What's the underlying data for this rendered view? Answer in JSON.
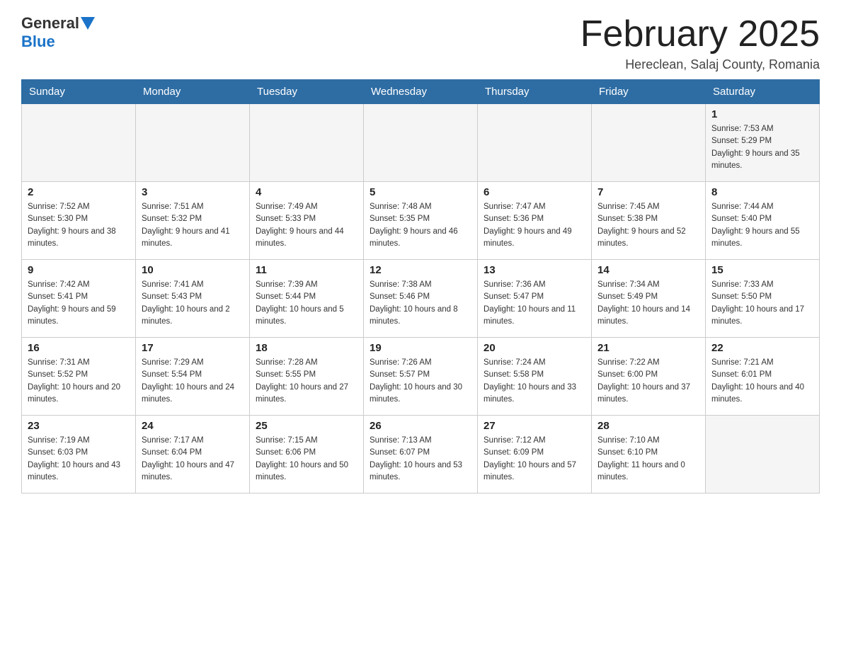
{
  "app": {
    "logo_general": "General",
    "logo_blue": "Blue"
  },
  "header": {
    "title": "February 2025",
    "subtitle": "Hereclean, Salaj County, Romania"
  },
  "weekdays": [
    "Sunday",
    "Monday",
    "Tuesday",
    "Wednesday",
    "Thursday",
    "Friday",
    "Saturday"
  ],
  "weeks": [
    [
      {
        "day": "",
        "info": ""
      },
      {
        "day": "",
        "info": ""
      },
      {
        "day": "",
        "info": ""
      },
      {
        "day": "",
        "info": ""
      },
      {
        "day": "",
        "info": ""
      },
      {
        "day": "",
        "info": ""
      },
      {
        "day": "1",
        "info": "Sunrise: 7:53 AM\nSunset: 5:29 PM\nDaylight: 9 hours and 35 minutes."
      }
    ],
    [
      {
        "day": "2",
        "info": "Sunrise: 7:52 AM\nSunset: 5:30 PM\nDaylight: 9 hours and 38 minutes."
      },
      {
        "day": "3",
        "info": "Sunrise: 7:51 AM\nSunset: 5:32 PM\nDaylight: 9 hours and 41 minutes."
      },
      {
        "day": "4",
        "info": "Sunrise: 7:49 AM\nSunset: 5:33 PM\nDaylight: 9 hours and 44 minutes."
      },
      {
        "day": "5",
        "info": "Sunrise: 7:48 AM\nSunset: 5:35 PM\nDaylight: 9 hours and 46 minutes."
      },
      {
        "day": "6",
        "info": "Sunrise: 7:47 AM\nSunset: 5:36 PM\nDaylight: 9 hours and 49 minutes."
      },
      {
        "day": "7",
        "info": "Sunrise: 7:45 AM\nSunset: 5:38 PM\nDaylight: 9 hours and 52 minutes."
      },
      {
        "day": "8",
        "info": "Sunrise: 7:44 AM\nSunset: 5:40 PM\nDaylight: 9 hours and 55 minutes."
      }
    ],
    [
      {
        "day": "9",
        "info": "Sunrise: 7:42 AM\nSunset: 5:41 PM\nDaylight: 9 hours and 59 minutes."
      },
      {
        "day": "10",
        "info": "Sunrise: 7:41 AM\nSunset: 5:43 PM\nDaylight: 10 hours and 2 minutes."
      },
      {
        "day": "11",
        "info": "Sunrise: 7:39 AM\nSunset: 5:44 PM\nDaylight: 10 hours and 5 minutes."
      },
      {
        "day": "12",
        "info": "Sunrise: 7:38 AM\nSunset: 5:46 PM\nDaylight: 10 hours and 8 minutes."
      },
      {
        "day": "13",
        "info": "Sunrise: 7:36 AM\nSunset: 5:47 PM\nDaylight: 10 hours and 11 minutes."
      },
      {
        "day": "14",
        "info": "Sunrise: 7:34 AM\nSunset: 5:49 PM\nDaylight: 10 hours and 14 minutes."
      },
      {
        "day": "15",
        "info": "Sunrise: 7:33 AM\nSunset: 5:50 PM\nDaylight: 10 hours and 17 minutes."
      }
    ],
    [
      {
        "day": "16",
        "info": "Sunrise: 7:31 AM\nSunset: 5:52 PM\nDaylight: 10 hours and 20 minutes."
      },
      {
        "day": "17",
        "info": "Sunrise: 7:29 AM\nSunset: 5:54 PM\nDaylight: 10 hours and 24 minutes."
      },
      {
        "day": "18",
        "info": "Sunrise: 7:28 AM\nSunset: 5:55 PM\nDaylight: 10 hours and 27 minutes."
      },
      {
        "day": "19",
        "info": "Sunrise: 7:26 AM\nSunset: 5:57 PM\nDaylight: 10 hours and 30 minutes."
      },
      {
        "day": "20",
        "info": "Sunrise: 7:24 AM\nSunset: 5:58 PM\nDaylight: 10 hours and 33 minutes."
      },
      {
        "day": "21",
        "info": "Sunrise: 7:22 AM\nSunset: 6:00 PM\nDaylight: 10 hours and 37 minutes."
      },
      {
        "day": "22",
        "info": "Sunrise: 7:21 AM\nSunset: 6:01 PM\nDaylight: 10 hours and 40 minutes."
      }
    ],
    [
      {
        "day": "23",
        "info": "Sunrise: 7:19 AM\nSunset: 6:03 PM\nDaylight: 10 hours and 43 minutes."
      },
      {
        "day": "24",
        "info": "Sunrise: 7:17 AM\nSunset: 6:04 PM\nDaylight: 10 hours and 47 minutes."
      },
      {
        "day": "25",
        "info": "Sunrise: 7:15 AM\nSunset: 6:06 PM\nDaylight: 10 hours and 50 minutes."
      },
      {
        "day": "26",
        "info": "Sunrise: 7:13 AM\nSunset: 6:07 PM\nDaylight: 10 hours and 53 minutes."
      },
      {
        "day": "27",
        "info": "Sunrise: 7:12 AM\nSunset: 6:09 PM\nDaylight: 10 hours and 57 minutes."
      },
      {
        "day": "28",
        "info": "Sunrise: 7:10 AM\nSunset: 6:10 PM\nDaylight: 11 hours and 0 minutes."
      },
      {
        "day": "",
        "info": ""
      }
    ]
  ]
}
